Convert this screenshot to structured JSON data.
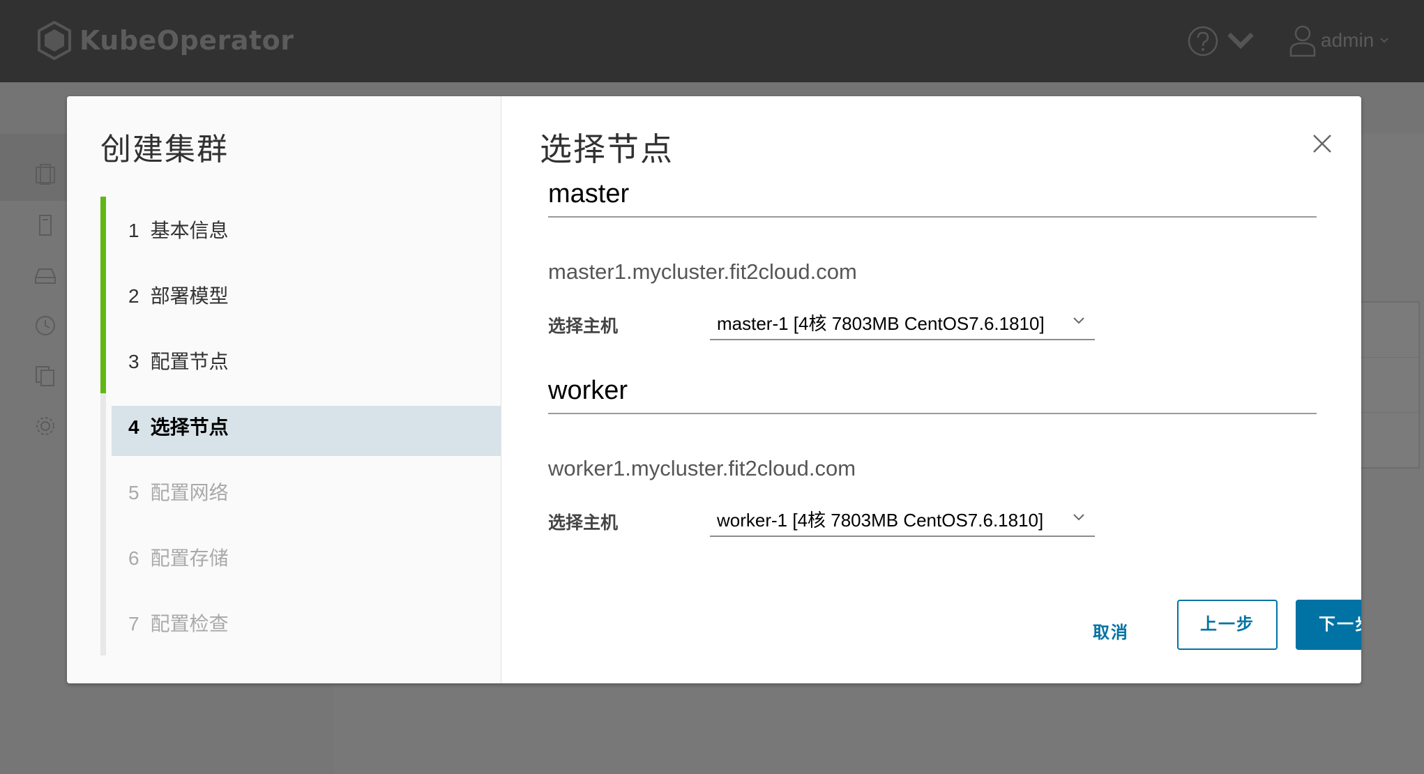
{
  "app": {
    "brand": "KubeOperator",
    "user_name": "admin"
  },
  "wizard": {
    "title": "创建集群",
    "steps": [
      {
        "num": "1",
        "label": "基本信息",
        "state": "done"
      },
      {
        "num": "2",
        "label": "部署模型",
        "state": "done"
      },
      {
        "num": "3",
        "label": "配置节点",
        "state": "done"
      },
      {
        "num": "4",
        "label": "选择节点",
        "state": "current"
      },
      {
        "num": "5",
        "label": "配置网络",
        "state": "todo"
      },
      {
        "num": "6",
        "label": "配置存储",
        "state": "todo"
      },
      {
        "num": "7",
        "label": "配置检查",
        "state": "todo"
      }
    ]
  },
  "panel": {
    "title": "选择节点",
    "sections": [
      {
        "role": "master",
        "hostname": "master1.mycluster.fit2cloud.com",
        "select_label": "选择主机",
        "selected": "master-1 [4核 7803MB CentOS7.6.1810]"
      },
      {
        "role": "worker",
        "hostname": "worker1.mycluster.fit2cloud.com",
        "select_label": "选择主机",
        "selected": "worker-1 [4核 7803MB CentOS7.6.1810]"
      }
    ]
  },
  "buttons": {
    "cancel": "取消",
    "prev": "上一步",
    "next": "下一步"
  },
  "colors": {
    "accent": "#0072a3",
    "done": "#61b715",
    "current_bg": "#d8e3e9"
  }
}
